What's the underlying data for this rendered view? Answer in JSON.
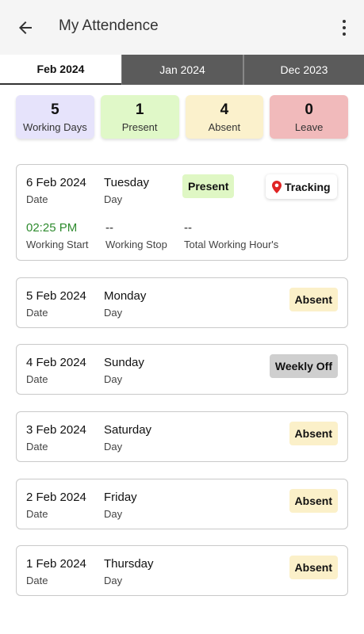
{
  "header": {
    "title": "My Attendence",
    "back_icon": "arrow-left-icon",
    "menu_icon": "more-vertical-icon"
  },
  "tabs": [
    {
      "label": "Feb 2024",
      "active": true
    },
    {
      "label": "Jan 2024",
      "active": false
    },
    {
      "label": "Dec 2023",
      "active": false
    }
  ],
  "summary": [
    {
      "value": "5",
      "label": "Working Days",
      "color": "#e6e3fb"
    },
    {
      "value": "1",
      "label": "Present",
      "color": "#e0f8c8"
    },
    {
      "value": "4",
      "label": "Absent",
      "color": "#fbf1cc"
    },
    {
      "value": "0",
      "label": "Leave",
      "color": "#f1babb"
    }
  ],
  "labels": {
    "date": "Date",
    "day": "Day",
    "working_start": "Working Start",
    "working_stop": "Working Stop",
    "total_hours": "Total Working Hour's",
    "tracking": "Tracking"
  },
  "records": [
    {
      "date": "6 Feb 2024",
      "day": "Tuesday",
      "status": "Present",
      "start": "02:25 PM",
      "stop": "--",
      "total": "--"
    },
    {
      "date": "5 Feb 2024",
      "day": "Monday",
      "status": "Absent"
    },
    {
      "date": "4 Feb 2024",
      "day": "Sunday",
      "status": "Weekly Off"
    },
    {
      "date": "3 Feb 2024",
      "day": "Saturday",
      "status": "Absent"
    },
    {
      "date": "2 Feb 2024",
      "day": "Friday",
      "status": "Absent"
    },
    {
      "date": "1 Feb 2024",
      "day": "Thursday",
      "status": "Absent"
    }
  ],
  "colors": {
    "present_text": "#2e8b2e",
    "pin": "#e02424"
  }
}
